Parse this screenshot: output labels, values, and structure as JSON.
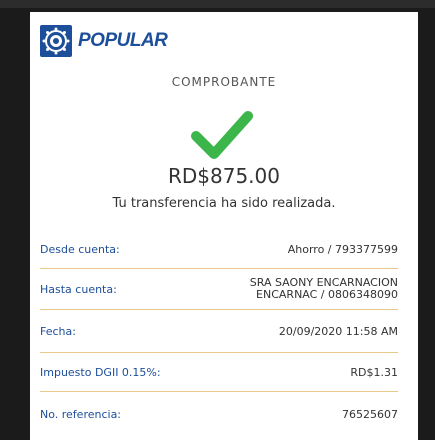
{
  "brand": {
    "name": "POPULAR",
    "color": "#1d4e9a"
  },
  "receipt": {
    "title": "COMPROBANTE",
    "status_icon": "check-icon",
    "amount": "RD$875.00",
    "message": "Tu transferencia ha sido realizada."
  },
  "details": [
    {
      "label": "Desde cuenta:",
      "value": "Ahorro / 793377599"
    },
    {
      "label": "Hasta cuenta:",
      "value_line1": "SRA SAONY ENCARNACION",
      "value_line2": "ENCARNAC / 0806348090"
    },
    {
      "label": "Fecha:",
      "value": "20/09/2020 11:58 AM"
    },
    {
      "label": "Impuesto DGII 0.15%:",
      "value": "RD$1.31"
    },
    {
      "label": "No. referencia:",
      "value": "76525607"
    }
  ],
  "colors": {
    "accent": "#1d4e9a",
    "check": "#3cb54a",
    "divider": "#e8c98a"
  }
}
